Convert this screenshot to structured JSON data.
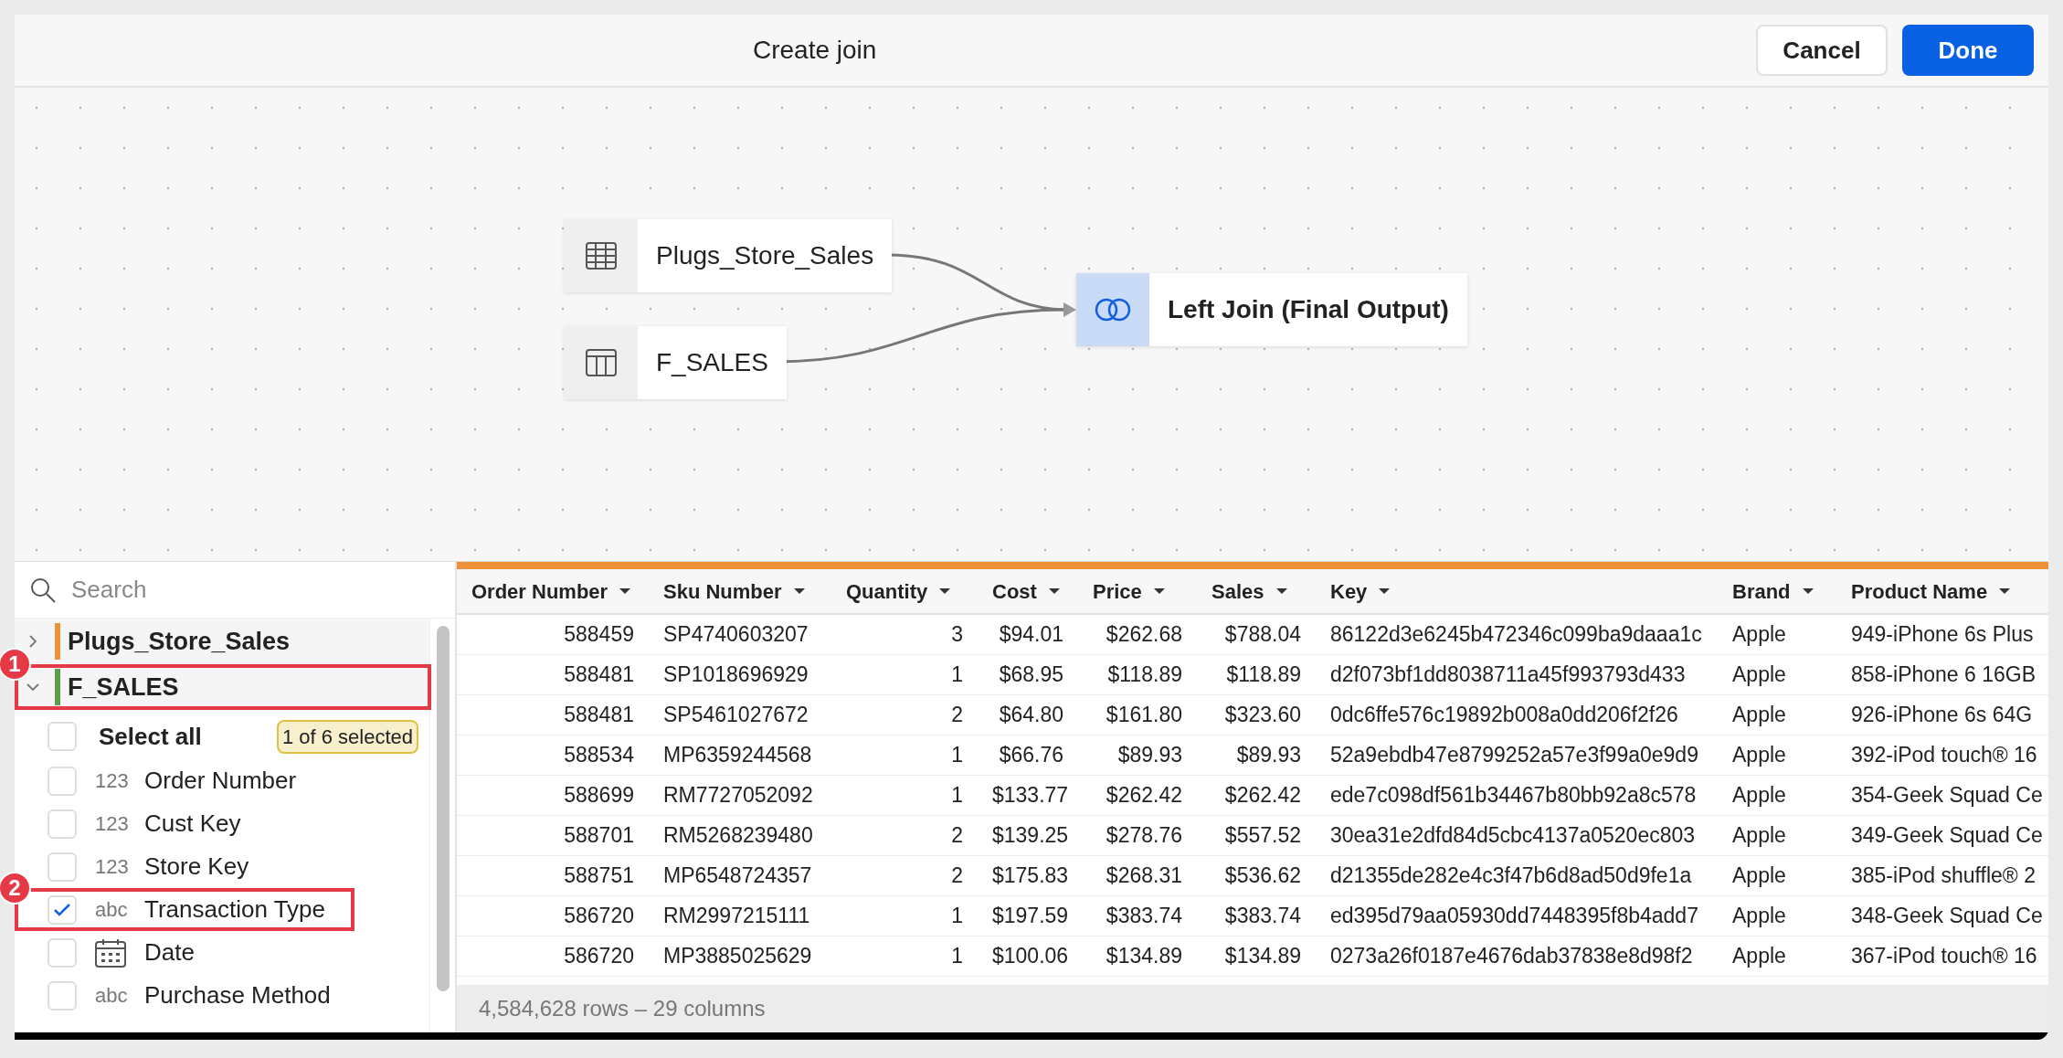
{
  "dialog": {
    "title": "Create join",
    "buttons": [
      {
        "label": "Cancel",
        "kind": "secondary"
      },
      {
        "label": "Done",
        "kind": "primary"
      }
    ]
  },
  "diagram": {
    "nodes": [
      {
        "kind": "table",
        "label": "Plugs_Store_Sales"
      },
      {
        "kind": "columns",
        "label": "F_SALES"
      },
      {
        "kind": "join",
        "label": "Left Join (Final Output)"
      }
    ]
  },
  "fields_panel": {
    "search": {
      "placeholder": "Search"
    },
    "sources": [
      {
        "name": "Plugs_Store_Sales",
        "color": "#f0903a",
        "expanded": false
      },
      {
        "name": "F_SALES",
        "color": "#5a9e4b",
        "expanded": true,
        "annotation": "1",
        "select_all": {
          "label": "Select all",
          "checked": false,
          "badge": "1 of 6 selected"
        },
        "fields": [
          {
            "kind": "number",
            "type_label": "123",
            "name": "Order Number",
            "checked": false
          },
          {
            "kind": "number",
            "type_label": "123",
            "name": "Cust Key",
            "checked": false
          },
          {
            "kind": "number",
            "type_label": "123",
            "name": "Store Key",
            "checked": false
          },
          {
            "kind": "text",
            "type_label": "abc",
            "name": "Transaction Type",
            "checked": true,
            "annotation": "2"
          },
          {
            "kind": "date",
            "name": "Date",
            "checked": false
          },
          {
            "kind": "text",
            "type_label": "abc",
            "name": "Purchase Method",
            "checked": false
          }
        ]
      }
    ]
  },
  "table": {
    "columns": [
      {
        "label": "Order Number"
      },
      {
        "label": "Sku Number"
      },
      {
        "label": "Quantity"
      },
      {
        "label": "Cost"
      },
      {
        "label": "Price"
      },
      {
        "label": "Sales"
      },
      {
        "label": "Key"
      },
      {
        "label": "Brand"
      },
      {
        "label": "Product Name"
      }
    ],
    "rows": [
      [
        "588459",
        "SP4740603207",
        "3",
        "$94.01",
        "$262.68",
        "$788.04",
        "86122d3e6245b472346c099ba9daaa1c",
        "Apple",
        "949-iPhone 6s Plus"
      ],
      [
        "588481",
        "SP1018696929",
        "1",
        "$68.95",
        "$118.89",
        "$118.89",
        "d2f073bf1dd8038711a45f993793d433",
        "Apple",
        "858-iPhone 6 16GB"
      ],
      [
        "588481",
        "SP5461027672",
        "2",
        "$64.80",
        "$161.80",
        "$323.60",
        "0dc6ffe576c19892b008a0dd206f2f26",
        "Apple",
        "926-iPhone 6s 64G"
      ],
      [
        "588534",
        "MP6359244568",
        "1",
        "$66.76",
        "$89.93",
        "$89.93",
        "52a9ebdb47e8799252a57e3f99a0e9d9",
        "Apple",
        "392-iPod touch® 16"
      ],
      [
        "588699",
        "RM7727052092",
        "1",
        "$133.77",
        "$262.42",
        "$262.42",
        "ede7c098df561b34467b80bb92a8c578",
        "Apple",
        "354-Geek Squad Ce"
      ],
      [
        "588701",
        "RM5268239480",
        "2",
        "$139.25",
        "$278.76",
        "$557.52",
        "30ea31e2dfd84d5cbc4137a0520ec803",
        "Apple",
        "349-Geek Squad Ce"
      ],
      [
        "588751",
        "MP6548724357",
        "2",
        "$175.83",
        "$268.31",
        "$536.62",
        "d21355de282e4c3f47b6d8ad50d9fe1a",
        "Apple",
        "385-iPod shuffle® 2"
      ],
      [
        "586720",
        "RM2997215111",
        "1",
        "$197.59",
        "$383.74",
        "$383.74",
        "ed395d79aa05930dd7448395f8b4add7",
        "Apple",
        "348-Geek Squad Ce"
      ],
      [
        "586720",
        "MP3885025629",
        "1",
        "$100.06",
        "$134.89",
        "$134.89",
        "0273a26f0187e4676dab37838e8d98f2",
        "Apple",
        "367-iPod touch® 16"
      ]
    ],
    "footer": "4,584,628 rows – 29 columns"
  }
}
